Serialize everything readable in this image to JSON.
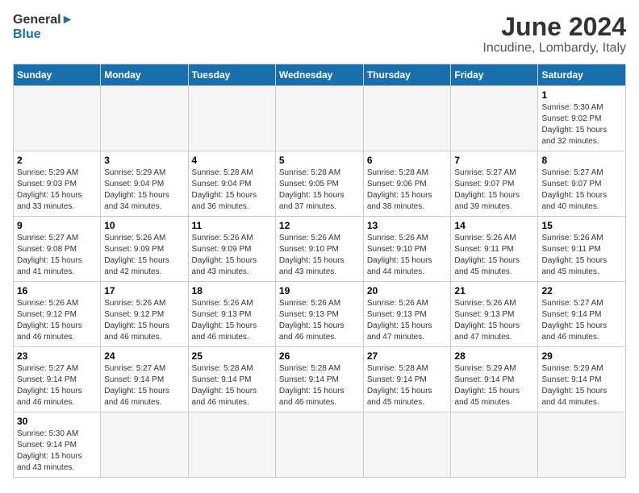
{
  "header": {
    "logo_general": "General",
    "logo_blue": "Blue",
    "title": "June 2024",
    "subtitle": "Incudine, Lombardy, Italy"
  },
  "days_of_week": [
    "Sunday",
    "Monday",
    "Tuesday",
    "Wednesday",
    "Thursday",
    "Friday",
    "Saturday"
  ],
  "weeks": [
    [
      {
        "day": "",
        "info": ""
      },
      {
        "day": "",
        "info": ""
      },
      {
        "day": "",
        "info": ""
      },
      {
        "day": "",
        "info": ""
      },
      {
        "day": "",
        "info": ""
      },
      {
        "day": "",
        "info": ""
      },
      {
        "day": "1",
        "info": "Sunrise: 5:30 AM\nSunset: 9:02 PM\nDaylight: 15 hours\nand 32 minutes."
      }
    ],
    [
      {
        "day": "2",
        "info": "Sunrise: 5:29 AM\nSunset: 9:03 PM\nDaylight: 15 hours\nand 33 minutes."
      },
      {
        "day": "3",
        "info": "Sunrise: 5:29 AM\nSunset: 9:04 PM\nDaylight: 15 hours\nand 34 minutes."
      },
      {
        "day": "4",
        "info": "Sunrise: 5:28 AM\nSunset: 9:04 PM\nDaylight: 15 hours\nand 36 minutes."
      },
      {
        "day": "5",
        "info": "Sunrise: 5:28 AM\nSunset: 9:05 PM\nDaylight: 15 hours\nand 37 minutes."
      },
      {
        "day": "6",
        "info": "Sunrise: 5:28 AM\nSunset: 9:06 PM\nDaylight: 15 hours\nand 38 minutes."
      },
      {
        "day": "7",
        "info": "Sunrise: 5:27 AM\nSunset: 9:07 PM\nDaylight: 15 hours\nand 39 minutes."
      },
      {
        "day": "8",
        "info": "Sunrise: 5:27 AM\nSunset: 9:07 PM\nDaylight: 15 hours\nand 40 minutes."
      }
    ],
    [
      {
        "day": "9",
        "info": "Sunrise: 5:27 AM\nSunset: 9:08 PM\nDaylight: 15 hours\nand 41 minutes."
      },
      {
        "day": "10",
        "info": "Sunrise: 5:26 AM\nSunset: 9:09 PM\nDaylight: 15 hours\nand 42 minutes."
      },
      {
        "day": "11",
        "info": "Sunrise: 5:26 AM\nSunset: 9:09 PM\nDaylight: 15 hours\nand 43 minutes."
      },
      {
        "day": "12",
        "info": "Sunrise: 5:26 AM\nSunset: 9:10 PM\nDaylight: 15 hours\nand 43 minutes."
      },
      {
        "day": "13",
        "info": "Sunrise: 5:26 AM\nSunset: 9:10 PM\nDaylight: 15 hours\nand 44 minutes."
      },
      {
        "day": "14",
        "info": "Sunrise: 5:26 AM\nSunset: 9:11 PM\nDaylight: 15 hours\nand 45 minutes."
      },
      {
        "day": "15",
        "info": "Sunrise: 5:26 AM\nSunset: 9:11 PM\nDaylight: 15 hours\nand 45 minutes."
      }
    ],
    [
      {
        "day": "16",
        "info": "Sunrise: 5:26 AM\nSunset: 9:12 PM\nDaylight: 15 hours\nand 46 minutes."
      },
      {
        "day": "17",
        "info": "Sunrise: 5:26 AM\nSunset: 9:12 PM\nDaylight: 15 hours\nand 46 minutes."
      },
      {
        "day": "18",
        "info": "Sunrise: 5:26 AM\nSunset: 9:13 PM\nDaylight: 15 hours\nand 46 minutes."
      },
      {
        "day": "19",
        "info": "Sunrise: 5:26 AM\nSunset: 9:13 PM\nDaylight: 15 hours\nand 46 minutes."
      },
      {
        "day": "20",
        "info": "Sunrise: 5:26 AM\nSunset: 9:13 PM\nDaylight: 15 hours\nand 47 minutes."
      },
      {
        "day": "21",
        "info": "Sunrise: 5:26 AM\nSunset: 9:13 PM\nDaylight: 15 hours\nand 47 minutes."
      },
      {
        "day": "22",
        "info": "Sunrise: 5:27 AM\nSunset: 9:14 PM\nDaylight: 15 hours\nand 46 minutes."
      }
    ],
    [
      {
        "day": "23",
        "info": "Sunrise: 5:27 AM\nSunset: 9:14 PM\nDaylight: 15 hours\nand 46 minutes."
      },
      {
        "day": "24",
        "info": "Sunrise: 5:27 AM\nSunset: 9:14 PM\nDaylight: 15 hours\nand 46 minutes."
      },
      {
        "day": "25",
        "info": "Sunrise: 5:28 AM\nSunset: 9:14 PM\nDaylight: 15 hours\nand 46 minutes."
      },
      {
        "day": "26",
        "info": "Sunrise: 5:28 AM\nSunset: 9:14 PM\nDaylight: 15 hours\nand 46 minutes."
      },
      {
        "day": "27",
        "info": "Sunrise: 5:28 AM\nSunset: 9:14 PM\nDaylight: 15 hours\nand 45 minutes."
      },
      {
        "day": "28",
        "info": "Sunrise: 5:29 AM\nSunset: 9:14 PM\nDaylight: 15 hours\nand 45 minutes."
      },
      {
        "day": "29",
        "info": "Sunrise: 5:29 AM\nSunset: 9:14 PM\nDaylight: 15 hours\nand 44 minutes."
      }
    ],
    [
      {
        "day": "30",
        "info": "Sunrise: 5:30 AM\nSunset: 9:14 PM\nDaylight: 15 hours\nand 43 minutes."
      },
      {
        "day": "",
        "info": ""
      },
      {
        "day": "",
        "info": ""
      },
      {
        "day": "",
        "info": ""
      },
      {
        "day": "",
        "info": ""
      },
      {
        "day": "",
        "info": ""
      },
      {
        "day": "",
        "info": ""
      }
    ]
  ]
}
